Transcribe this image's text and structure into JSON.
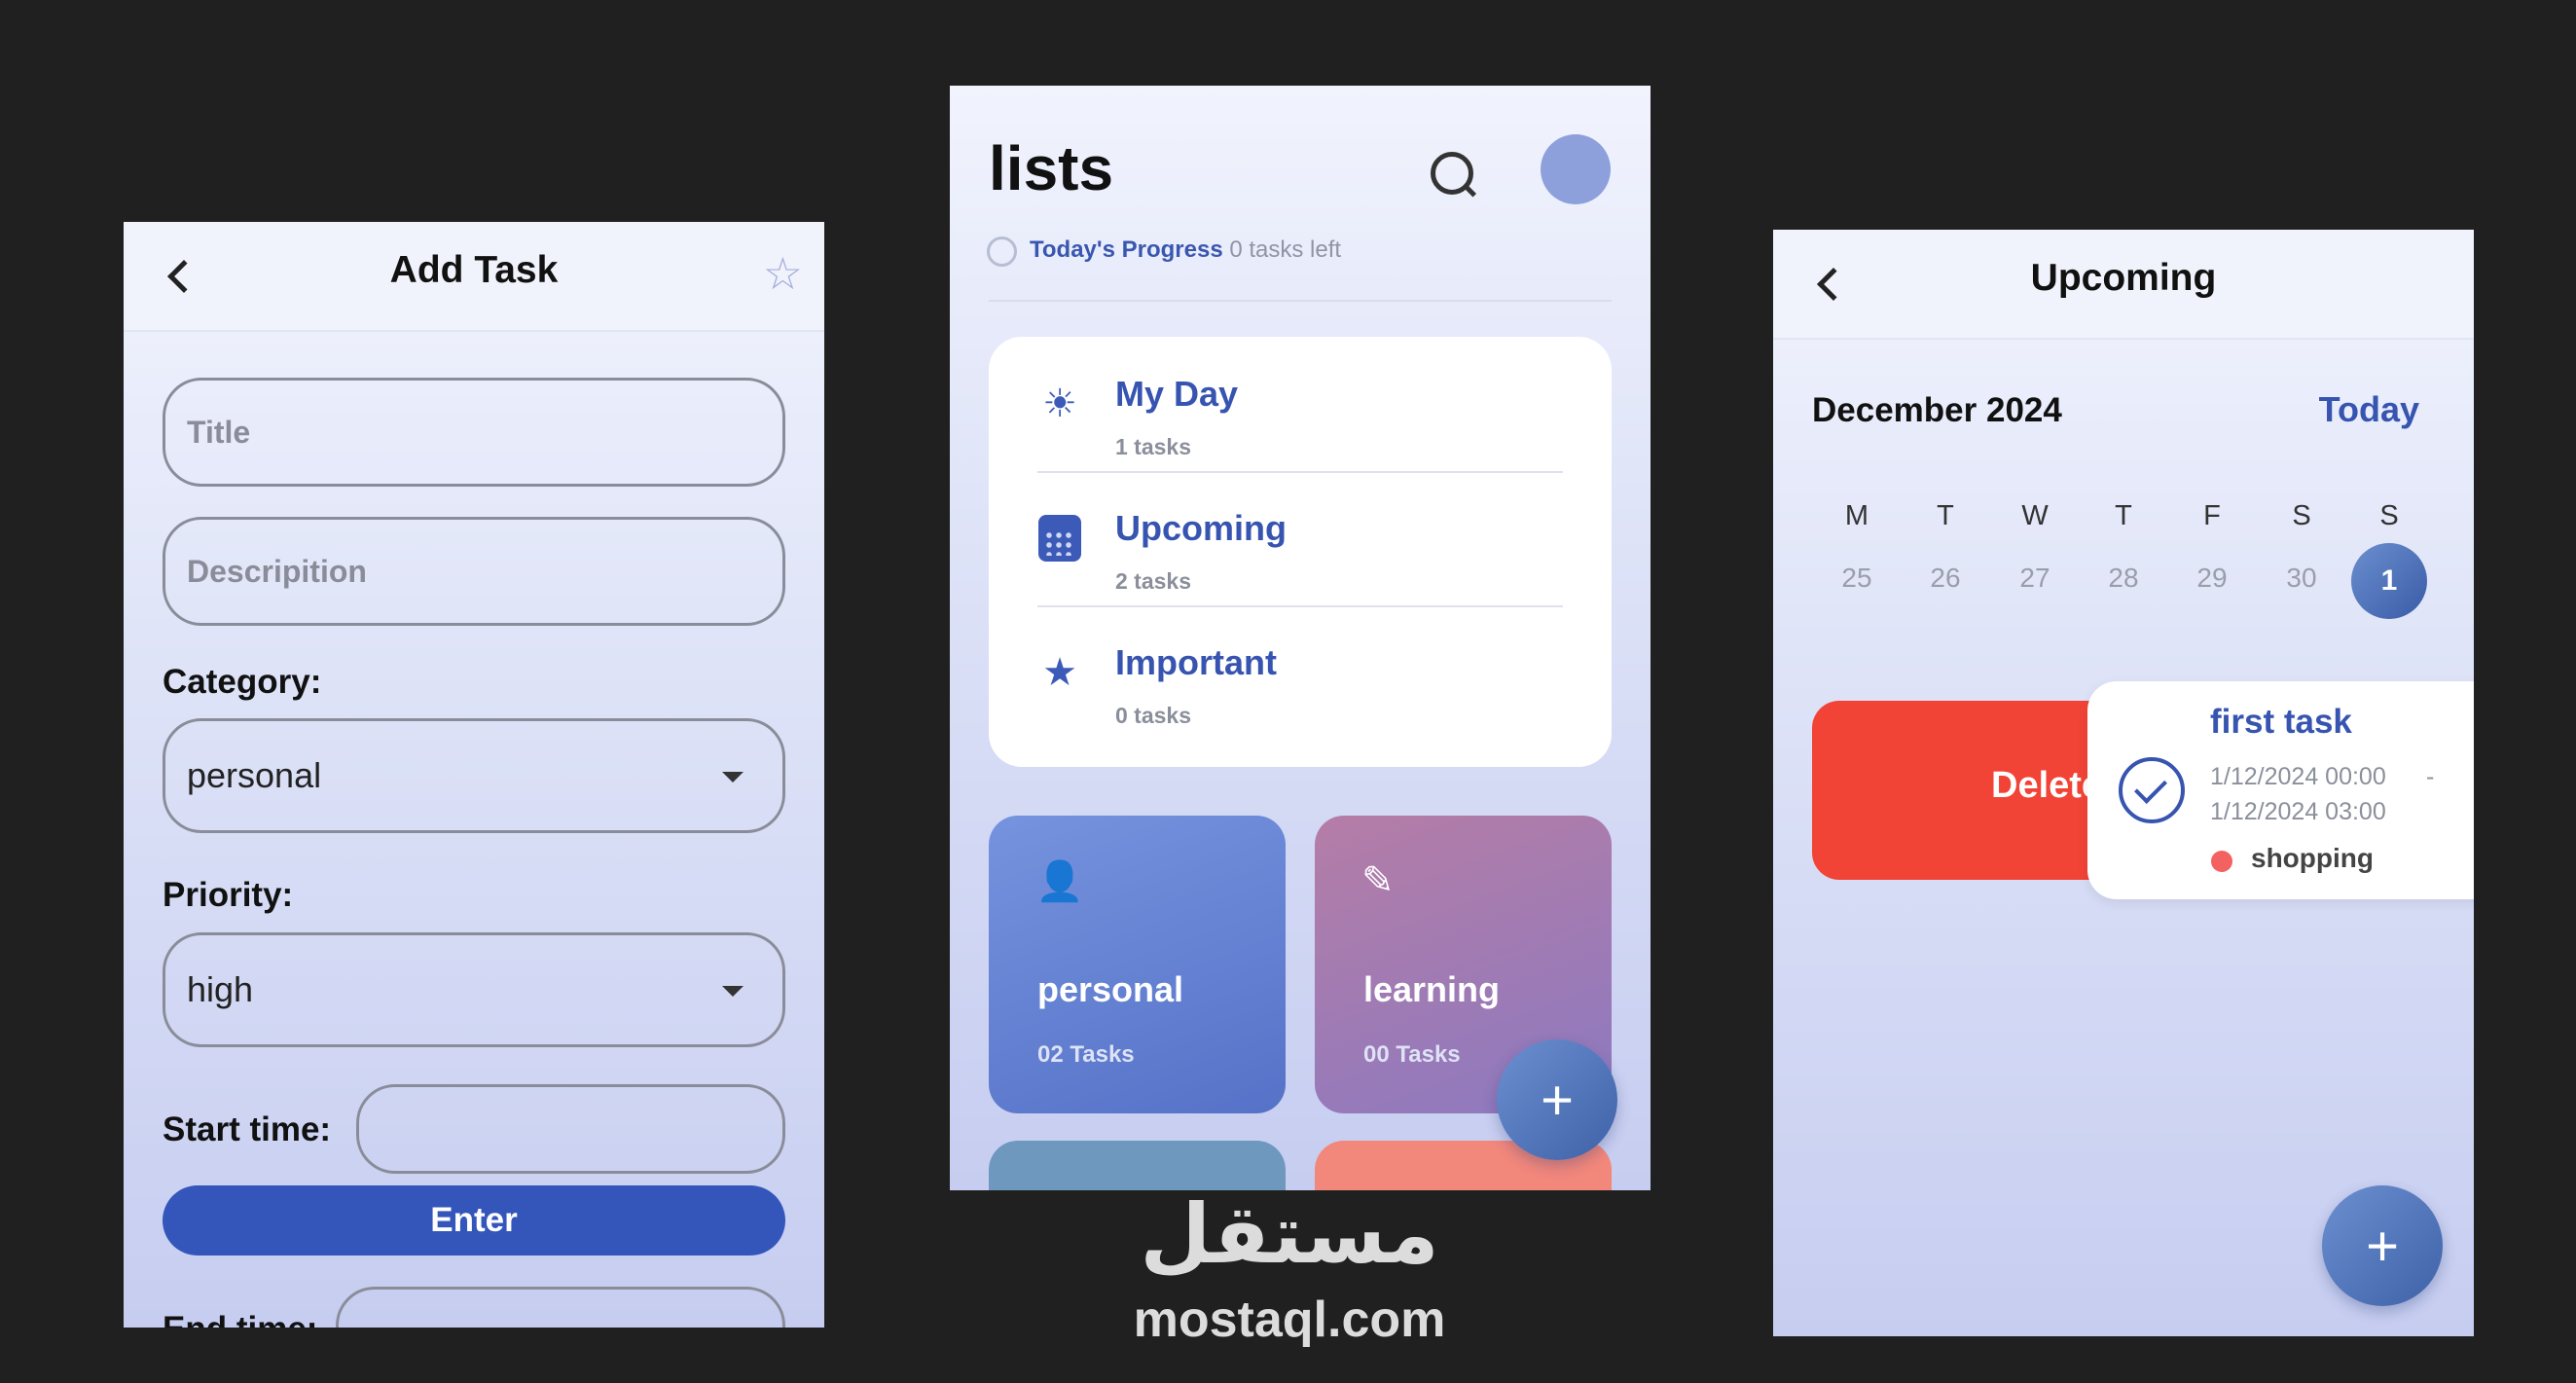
{
  "add_task": {
    "title": "Add Task",
    "title_placeholder": "Title",
    "description_placeholder": "Descripition",
    "category_label": "Category:",
    "category_value": "personal",
    "priority_label": "Priority:",
    "priority_value": "high",
    "start_time_label": "Start time:",
    "enter_label": "Enter",
    "end_time_label": "End time:"
  },
  "lists": {
    "title": "lists",
    "progress_label": "Today's Progress",
    "progress_value": "0 tasks left",
    "items": [
      {
        "name": "My Day",
        "count": "1 tasks",
        "icon": "sun-icon"
      },
      {
        "name": "Upcoming",
        "count": "2 tasks",
        "icon": "calendar-icon"
      },
      {
        "name": "Important",
        "count": "0 tasks",
        "icon": "star-icon"
      }
    ],
    "tiles": [
      {
        "name": "personal",
        "count": "02 Tasks",
        "icon": "person-icon",
        "color": "#6b86d6"
      },
      {
        "name": "learning",
        "count": "00 Tasks",
        "icon": "pencil-icon",
        "color": "#a17ab4"
      }
    ],
    "fab_label": "+"
  },
  "upcoming": {
    "title": "Upcoming",
    "month": "December 2024",
    "today_label": "Today",
    "days": [
      "M",
      "T",
      "W",
      "T",
      "F",
      "S",
      "S"
    ],
    "dates": [
      "25",
      "26",
      "27",
      "28",
      "29",
      "30",
      "1"
    ],
    "selected_date": "1",
    "delete_label": "Delete",
    "task": {
      "title": "first task",
      "start": "1/12/2024   00:00",
      "separator": "-",
      "end": "1/12/2024   03:00",
      "category": "shopping",
      "category_color": "#f36161"
    },
    "fab_label": "+"
  },
  "watermark": {
    "arabic": "مستقل",
    "latin": "mostaql.com"
  },
  "colors": {
    "accent": "#3654b0",
    "button": "#3456bb",
    "delete": "#f14436",
    "background": "#202020"
  }
}
